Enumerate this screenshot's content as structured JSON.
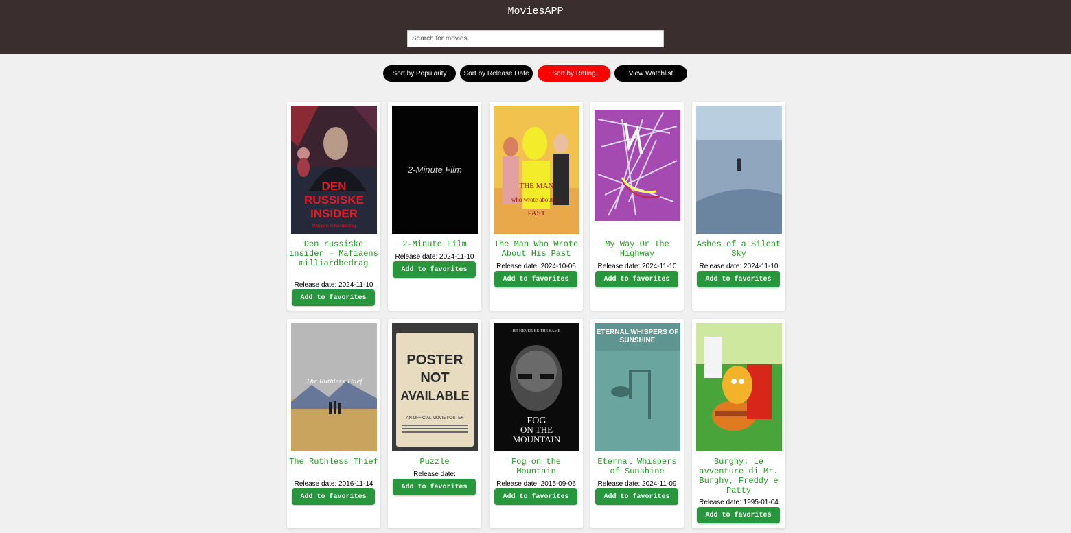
{
  "app": {
    "title": "MoviesAPP",
    "search_placeholder": "Search for movies..."
  },
  "sort": {
    "popularity": "Sort by Popularity",
    "release": "Sort by Release Date",
    "rating": "Sort by Rating",
    "watchlist": "View Watchlist",
    "active": "rating",
    "active_color": "#ff0000"
  },
  "favorite_label": "Add to favorites",
  "movies": [
    {
      "title": "Den russiske insider – Mafiaens milliardbedrag",
      "release": "Release date: 2024-11-10",
      "poster_text": "DEN RUSSISKE INSIDER",
      "poster_subtext": "Mafiaens milliardbedrag"
    },
    {
      "title": "2-Minute Film",
      "release": "Release date: 2024-11-10",
      "poster_text": "2-Minute Film"
    },
    {
      "title": "The Man Who Wrote About His Past",
      "release": "Release date: 2024-10-06",
      "poster_text": "THE MAN who wrote about his PAST"
    },
    {
      "title": "My Way Or The Highway",
      "release": "Release date: 2024-11-10"
    },
    {
      "title": "Ashes of a Silent Sky",
      "release": "Release date: 2024-11-10"
    },
    {
      "title": "The Ruthless Thief",
      "release": "Release date: 2016-11-14",
      "poster_text": "The Ruthless Thief"
    },
    {
      "title": "Puzzle",
      "release": "Release date:",
      "poster_text": "POSTER NOT AVAILABLE",
      "poster_subtext": "AN OFFICIAL MOVIE POSTER"
    },
    {
      "title": "Fog on the Mountain",
      "release": "Release date: 2015-09-06",
      "poster_text": "FOG ON THE MOUNTAIN",
      "poster_subtext": "HE NEVER BE THE SAME"
    },
    {
      "title": "Eternal Whispers of Sunshine",
      "release": "Release date: 2024-11-09",
      "poster_text": "ETERNAL WHISPERS OF SUNSHINE"
    },
    {
      "title": "Burghy: Le avventure di Mr. Burghy, Freddy e Patty",
      "release": "Release date: 1995-01-04"
    }
  ]
}
